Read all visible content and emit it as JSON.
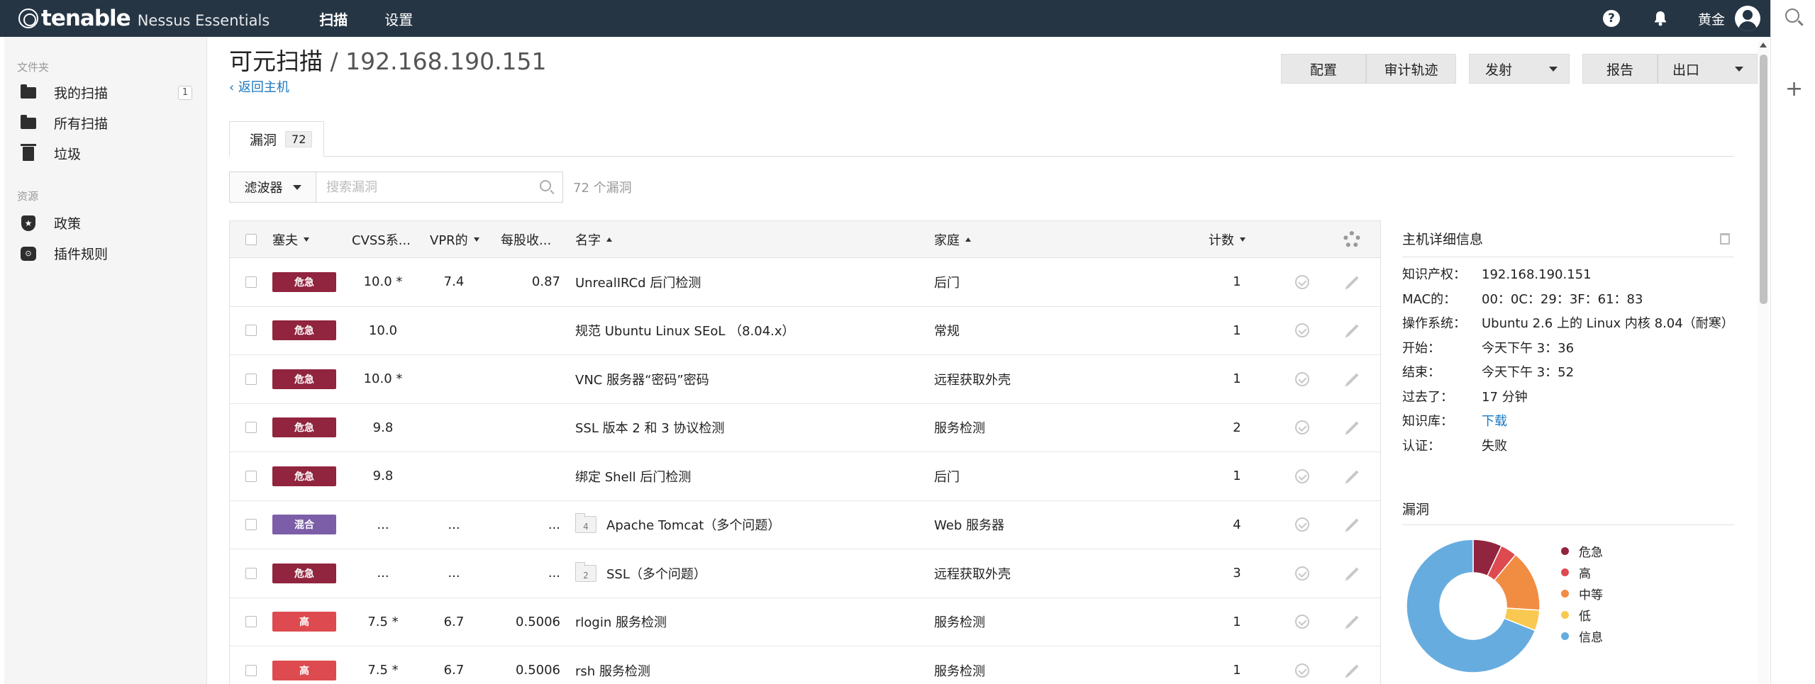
{
  "topbar": {
    "brand": "tenable",
    "product": "Nessus Essentials",
    "nav": [
      {
        "label": "扫描",
        "active": true
      },
      {
        "label": "设置",
        "active": false
      }
    ],
    "user_name": "黄金",
    "icons": [
      "help-icon",
      "bell-icon",
      "user-avatar-icon"
    ]
  },
  "sidebar": {
    "folders_heading": "文件夹",
    "folders": [
      {
        "label": "我的扫描",
        "icon": "folder-icon",
        "badge": "1"
      },
      {
        "label": "所有扫描",
        "icon": "folder-icon"
      },
      {
        "label": "垃圾",
        "icon": "trash-icon"
      }
    ],
    "resources_heading": "资源",
    "resources": [
      {
        "label": "政策",
        "icon": "policy-shield-icon"
      },
      {
        "label": "插件规则",
        "icon": "plugin-icon"
      }
    ]
  },
  "header": {
    "title": "可元扫描",
    "separator": "/",
    "host": "192.168.190.151",
    "back_link": "‹ 返回主机",
    "actions": {
      "configure": "配置",
      "audit_trail": "审计轨迹",
      "launch": "发射",
      "report": "报告",
      "export": "出口"
    }
  },
  "tabs": [
    {
      "label": "漏洞",
      "count": "72"
    }
  ],
  "filter": {
    "button": "滤波器",
    "search_placeholder": "搜索漏洞",
    "result_count": "72 个漏洞"
  },
  "table": {
    "columns": {
      "severity": "塞夫",
      "cvss": "CVSS系...",
      "vpr": "VPR的",
      "epss": "每股收...",
      "name": "名字",
      "family": "家庭",
      "count": "计数"
    },
    "rows": [
      {
        "severity": "危急",
        "sev_color": "#91243e",
        "cvss": "10.0 *",
        "vpr": "7.4",
        "epss": "0.87",
        "name": "UnrealIRCd 后门检测",
        "group_count": "",
        "family": "后门",
        "count": "1"
      },
      {
        "severity": "危急",
        "sev_color": "#91243e",
        "cvss": "10.0",
        "vpr": "",
        "epss": "",
        "name": "规范 Ubuntu Linux SEoL （8.04.x）",
        "group_count": "",
        "family": "常规",
        "count": "1"
      },
      {
        "severity": "危急",
        "sev_color": "#91243e",
        "cvss": "10.0 *",
        "vpr": "",
        "epss": "",
        "name": "VNC 服务器“密码”密码",
        "group_count": "",
        "family": "远程获取外壳",
        "count": "1"
      },
      {
        "severity": "危急",
        "sev_color": "#91243e",
        "cvss": "9.8",
        "vpr": "",
        "epss": "",
        "name": "SSL 版本 2 和 3 协议检测",
        "group_count": "",
        "family": "服务检测",
        "count": "2"
      },
      {
        "severity": "危急",
        "sev_color": "#91243e",
        "cvss": "9.8",
        "vpr": "",
        "epss": "",
        "name": "绑定 Shell 后门检测",
        "group_count": "",
        "family": "后门",
        "count": "1"
      },
      {
        "severity": "混合",
        "sev_color": "#7b5ea7",
        "cvss": "...",
        "vpr": "...",
        "epss": "...",
        "name": "Apache Tomcat（多个问题）",
        "group_count": "4",
        "family": "Web 服务器",
        "count": "4"
      },
      {
        "severity": "危急",
        "sev_color": "#91243e",
        "cvss": "...",
        "vpr": "...",
        "epss": "...",
        "name": "SSL（多个问题）",
        "group_count": "2",
        "family": "远程获取外壳",
        "count": "3"
      },
      {
        "severity": "高",
        "sev_color": "#dd4b50",
        "cvss": "7.5 *",
        "vpr": "6.7",
        "epss": "0.5006",
        "name": "rlogin 服务检测",
        "group_count": "",
        "family": "服务检测",
        "count": "1"
      },
      {
        "severity": "高",
        "sev_color": "#dd4b50",
        "cvss": "7.5 *",
        "vpr": "6.7",
        "epss": "0.5006",
        "name": "rsh 服务检测",
        "group_count": "",
        "family": "服务检测",
        "count": "1"
      }
    ]
  },
  "host_details": {
    "heading": "主机详细信息",
    "rows": [
      {
        "label": "知识产权：",
        "value": "192.168.190.151"
      },
      {
        "label": "MAC的：",
        "value": "00：0C：29：3F：61：83"
      },
      {
        "label": "操作系统：",
        "value": "Ubuntu 2.6 上的 Linux 内核 8.04（耐寒）"
      },
      {
        "label": "开始：",
        "value": "今天下午 3：36"
      },
      {
        "label": "结束：",
        "value": "今天下午 3：52"
      },
      {
        "label": "过去了：",
        "value": "17 分钟"
      },
      {
        "label": "知识库：",
        "value": "下载",
        "link": true
      },
      {
        "label": "认证：",
        "value": "失败"
      }
    ]
  },
  "vuln_summary": {
    "heading": "漏洞",
    "chart_data": {
      "type": "pie",
      "donut": true,
      "categories": [
        "危急",
        "高",
        "中等",
        "低",
        "信息"
      ],
      "values": [
        7,
        4,
        15,
        5,
        69
      ],
      "colors": [
        "#91243e",
        "#dd4b50",
        "#f18c43",
        "#f8c851",
        "#67acdf"
      ]
    }
  }
}
